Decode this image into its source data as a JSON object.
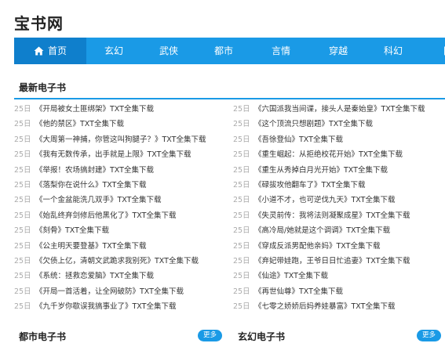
{
  "site": {
    "title": "宝书网"
  },
  "nav": {
    "items": [
      {
        "label": "首页",
        "active": true
      },
      {
        "label": "玄幻"
      },
      {
        "label": "武侠"
      },
      {
        "label": "都市"
      },
      {
        "label": "言情"
      },
      {
        "label": "穿越"
      },
      {
        "label": "科幻"
      },
      {
        "label": "网"
      }
    ]
  },
  "latest": {
    "title": "最新电子书",
    "left": [
      {
        "day": "25日",
        "title": "《开局被女土匪绑架》TXT全集下载"
      },
      {
        "day": "25日",
        "title": "《他的禁区》TXT全集下载"
      },
      {
        "day": "25日",
        "title": "《大周第一神捕，你管这叫狗腿子？》TXT全集下载"
      },
      {
        "day": "25日",
        "title": "《我有无数传承，出手就是上限》TXT全集下载"
      },
      {
        "day": "25日",
        "title": "《举报！农场搞封建》TXT全集下载"
      },
      {
        "day": "25日",
        "title": "《落梨你在说什么》TXT全集下载"
      },
      {
        "day": "25日",
        "title": "《一个金盆能洗几双手》TXT全集下载"
      },
      {
        "day": "25日",
        "title": "《始乱终弃剑修后他黑化了》TXT全集下载"
      },
      {
        "day": "25日",
        "title": "《刻骨》TXT全集下载"
      },
      {
        "day": "25日",
        "title": "《公主明天要登基》TXT全集下载"
      },
      {
        "day": "25日",
        "title": "《欠债上亿，清朝文武跪求我别死》TXT全集下载"
      },
      {
        "day": "25日",
        "title": "《系统：拯救恋爱脑》TXT全集下载"
      },
      {
        "day": "25日",
        "title": "《开局一首活着，让全网破防》TXT全集下载"
      },
      {
        "day": "25日",
        "title": "《九千岁你歇误我搞事业了》TXT全集下载"
      }
    ],
    "right": [
      {
        "day": "25日",
        "title": "《六国派我当间谍，接头人是秦始皇》TXT全集下载"
      },
      {
        "day": "25日",
        "title": "《这个顶流只想剧题》TXT全集下载"
      },
      {
        "day": "25日",
        "title": "《吾徐登仙》TXT全集下载"
      },
      {
        "day": "25日",
        "title": "《重生崛起：从拒绝校花开始》TXT全集下载"
      },
      {
        "day": "25日",
        "title": "《重生从秀掉白月光开始》TXT全集下载"
      },
      {
        "day": "25日",
        "title": "《碌拔攻他翻车了》TXT全集下载"
      },
      {
        "day": "25日",
        "title": "《小道不才，也可逆伐九天》TXT全集下载"
      },
      {
        "day": "25日",
        "title": "《失灵前传：我将法则凝聚成星》TXT全集下载"
      },
      {
        "day": "25日",
        "title": "《高冷局/她就是这个调调》TXT全集下载"
      },
      {
        "day": "25日",
        "title": "《穿成反派男配他亲妈》TXT全集下载"
      },
      {
        "day": "25日",
        "title": "《弃妃带娃跑，王爷日日忙追妻》TXT全集下载"
      },
      {
        "day": "25日",
        "title": "《仙途》TXT全集下载"
      },
      {
        "day": "25日",
        "title": "《再世仙尊》TXT全集下载"
      },
      {
        "day": "25日",
        "title": "《七零之娇娇后妈养娃暴富》TXT全集下载"
      }
    ]
  },
  "urban": {
    "title": "都市电子书",
    "more": "更多"
  },
  "fantasy": {
    "title": "玄幻电子书",
    "more": "更多"
  },
  "colors": {
    "accent": "#1a9ae6",
    "nav_active": "#0f7fcc"
  },
  "icons": {
    "home": "home-icon"
  }
}
